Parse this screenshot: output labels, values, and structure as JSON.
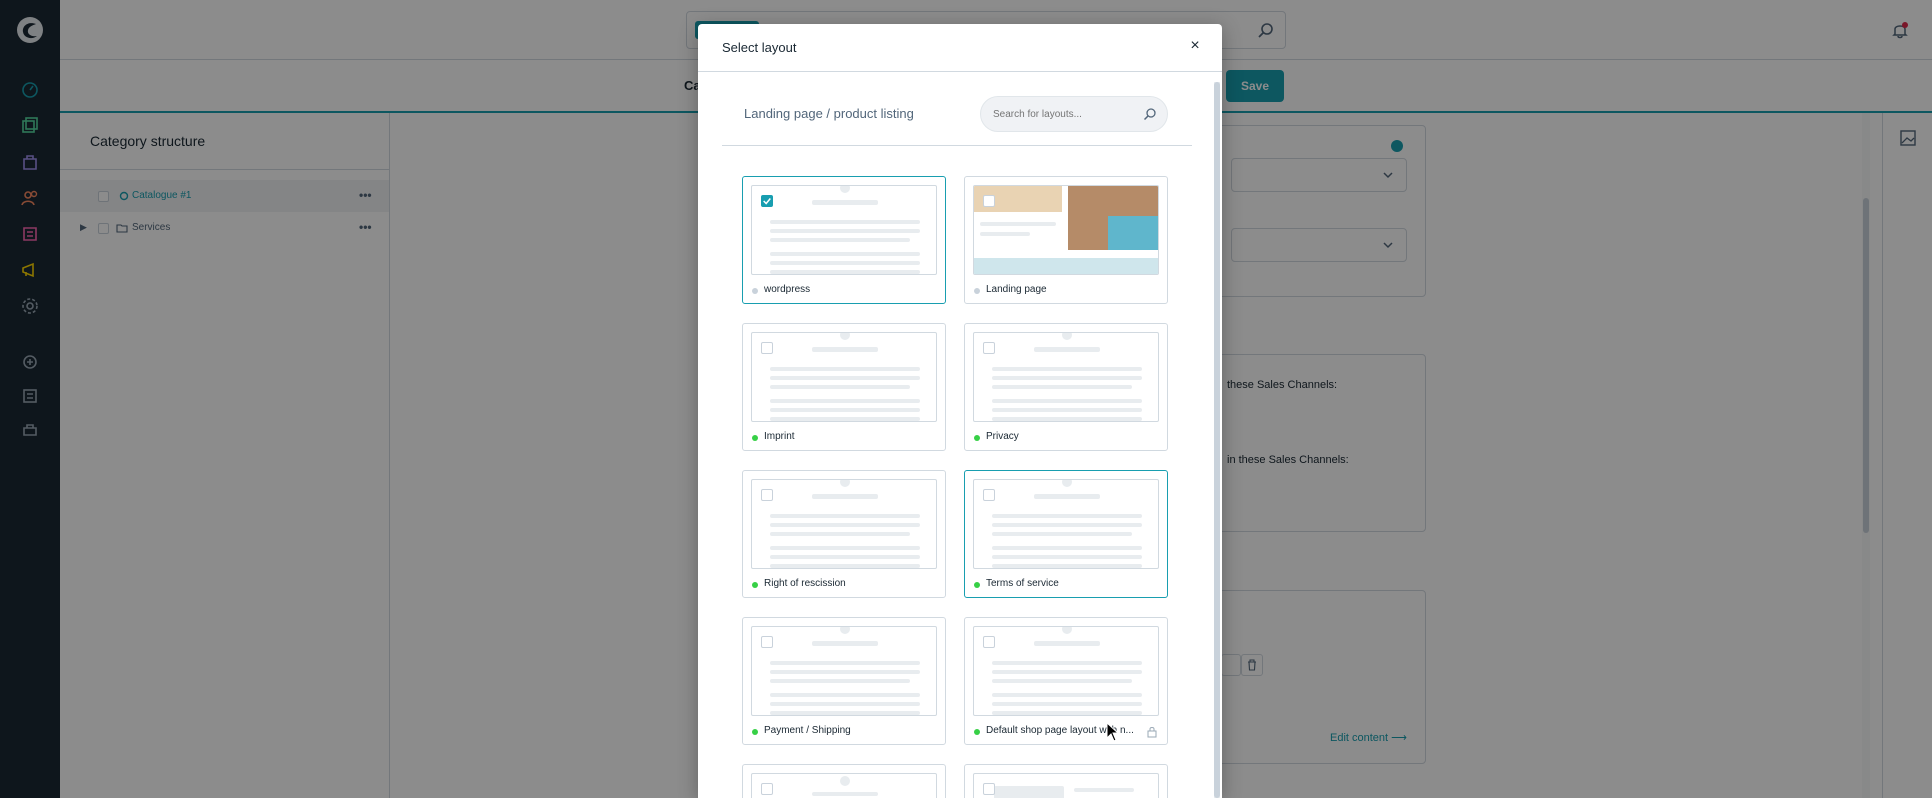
{
  "app": {
    "save_label": "Save",
    "smartbar_label": "Ca"
  },
  "tree": {
    "title": "Category structure",
    "items": [
      {
        "label": "Catalogue #1",
        "selected": true
      },
      {
        "label": "Services",
        "selected": false
      }
    ]
  },
  "content": {
    "sales_channels_1": "these Sales Channels:",
    "sales_channels_2": "in these Sales Channels:",
    "edit_content": "Edit content"
  },
  "modal": {
    "title": "Select layout",
    "close_label": "×",
    "section_label": "Landing page / product listing",
    "search_placeholder": "Search for layouts...",
    "layouts": [
      {
        "name": "wordpress",
        "checked": true,
        "active": true,
        "status": "inactive"
      },
      {
        "name": "Landing page",
        "checked": false,
        "active": false,
        "status": "inactive"
      },
      {
        "name": "Imprint",
        "checked": false,
        "active": false,
        "status": "active"
      },
      {
        "name": "Privacy",
        "checked": false,
        "active": false,
        "status": "active"
      },
      {
        "name": "Right of rescission",
        "checked": false,
        "active": false,
        "status": "active"
      },
      {
        "name": "Terms of service",
        "checked": false,
        "active": true,
        "status": "active"
      },
      {
        "name": "Payment / Shipping",
        "checked": false,
        "active": false,
        "status": "active"
      },
      {
        "name": "Default shop page layout with n...",
        "checked": false,
        "active": false,
        "status": "active",
        "locked": true
      }
    ]
  },
  "colors": {
    "accent": "#189eb0",
    "nav_bg": "#1a2833",
    "status_active": "#37d046"
  }
}
